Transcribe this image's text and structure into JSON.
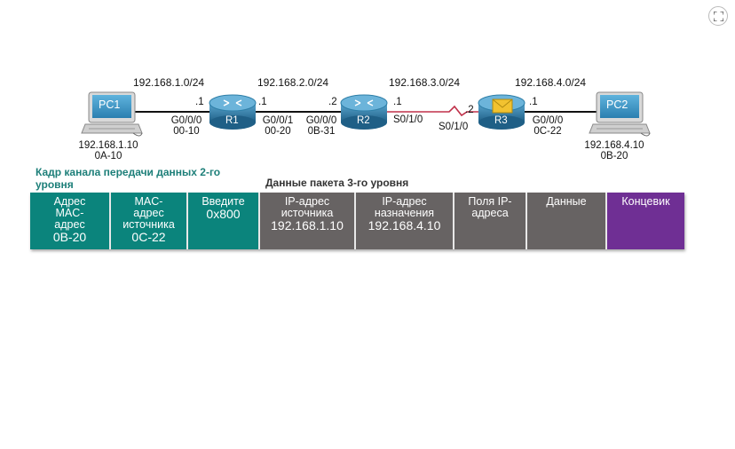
{
  "colors": {
    "teal": "#0b847c",
    "gray": "#676363",
    "purple": "#6f2f94",
    "heading_teal": "#1d7f79",
    "router_blue": "#2f7fa8",
    "serial_link": "#c0304a"
  },
  "toolbar": {
    "fullscreen_icon": "expand-icon"
  },
  "topology": {
    "networks": [
      "192.168.1.0/24",
      "192.168.2.0/24",
      "192.168.3.0/24",
      "192.168.4.0/24"
    ],
    "pc1": {
      "name": "PC1",
      "ip": "192.168.1.10",
      "mac": "0A-10"
    },
    "pc2": {
      "name": "PC2",
      "ip": "192.168.4.10",
      "mac": "0B-20"
    },
    "r1": {
      "name": "R1",
      "left_host": ".1",
      "right_host": ".1",
      "if_left": "G0/0/0",
      "mac_left": "00-10",
      "if_right": "G0/0/1",
      "mac_right": "00-20"
    },
    "r2": {
      "name": "R2",
      "left_host": ".2",
      "right_host": ".1",
      "if_left": "G0/0/0",
      "mac_left": "0B-31",
      "if_right": "S0/1/0"
    },
    "r3": {
      "name": "R3",
      "left_host": ".2",
      "right_host": ".1",
      "if_left": "S0/1/0",
      "if_right": "G0/0/0",
      "mac_right": "0C-22"
    },
    "envelope_icon": "envelope-icon"
  },
  "frame": {
    "l2_heading": "Кадр канала передачи данных 2-го уровня",
    "l3_heading": "Данные пакета 3-го уровня",
    "cells": [
      {
        "lines": [
          "Адрес",
          "MAC-",
          "адрес"
        ],
        "value": "0B-20",
        "color": "teal",
        "width": 91
      },
      {
        "lines": [
          "MAC-",
          "адрес",
          "источника"
        ],
        "value": "0C-22",
        "color": "teal",
        "width": 87
      },
      {
        "lines": [
          "Введите"
        ],
        "value": "0x800",
        "color": "teal",
        "width": 81
      },
      {
        "lines": [
          "IP-адрес",
          "источника"
        ],
        "value": "192.168.1.10",
        "color": "gray",
        "width": 108
      },
      {
        "lines": [
          "IP-адрес",
          "назначения"
        ],
        "value": "192.168.4.10",
        "color": "gray",
        "width": 111
      },
      {
        "lines": [
          "Поля IP-",
          "адреса"
        ],
        "value": "",
        "color": "gray",
        "width": 82
      },
      {
        "lines": [
          "Данные"
        ],
        "value": "",
        "color": "gray",
        "width": 90
      },
      {
        "lines": [
          "Концевик"
        ],
        "value": "",
        "color": "purple",
        "width": 87
      }
    ]
  }
}
